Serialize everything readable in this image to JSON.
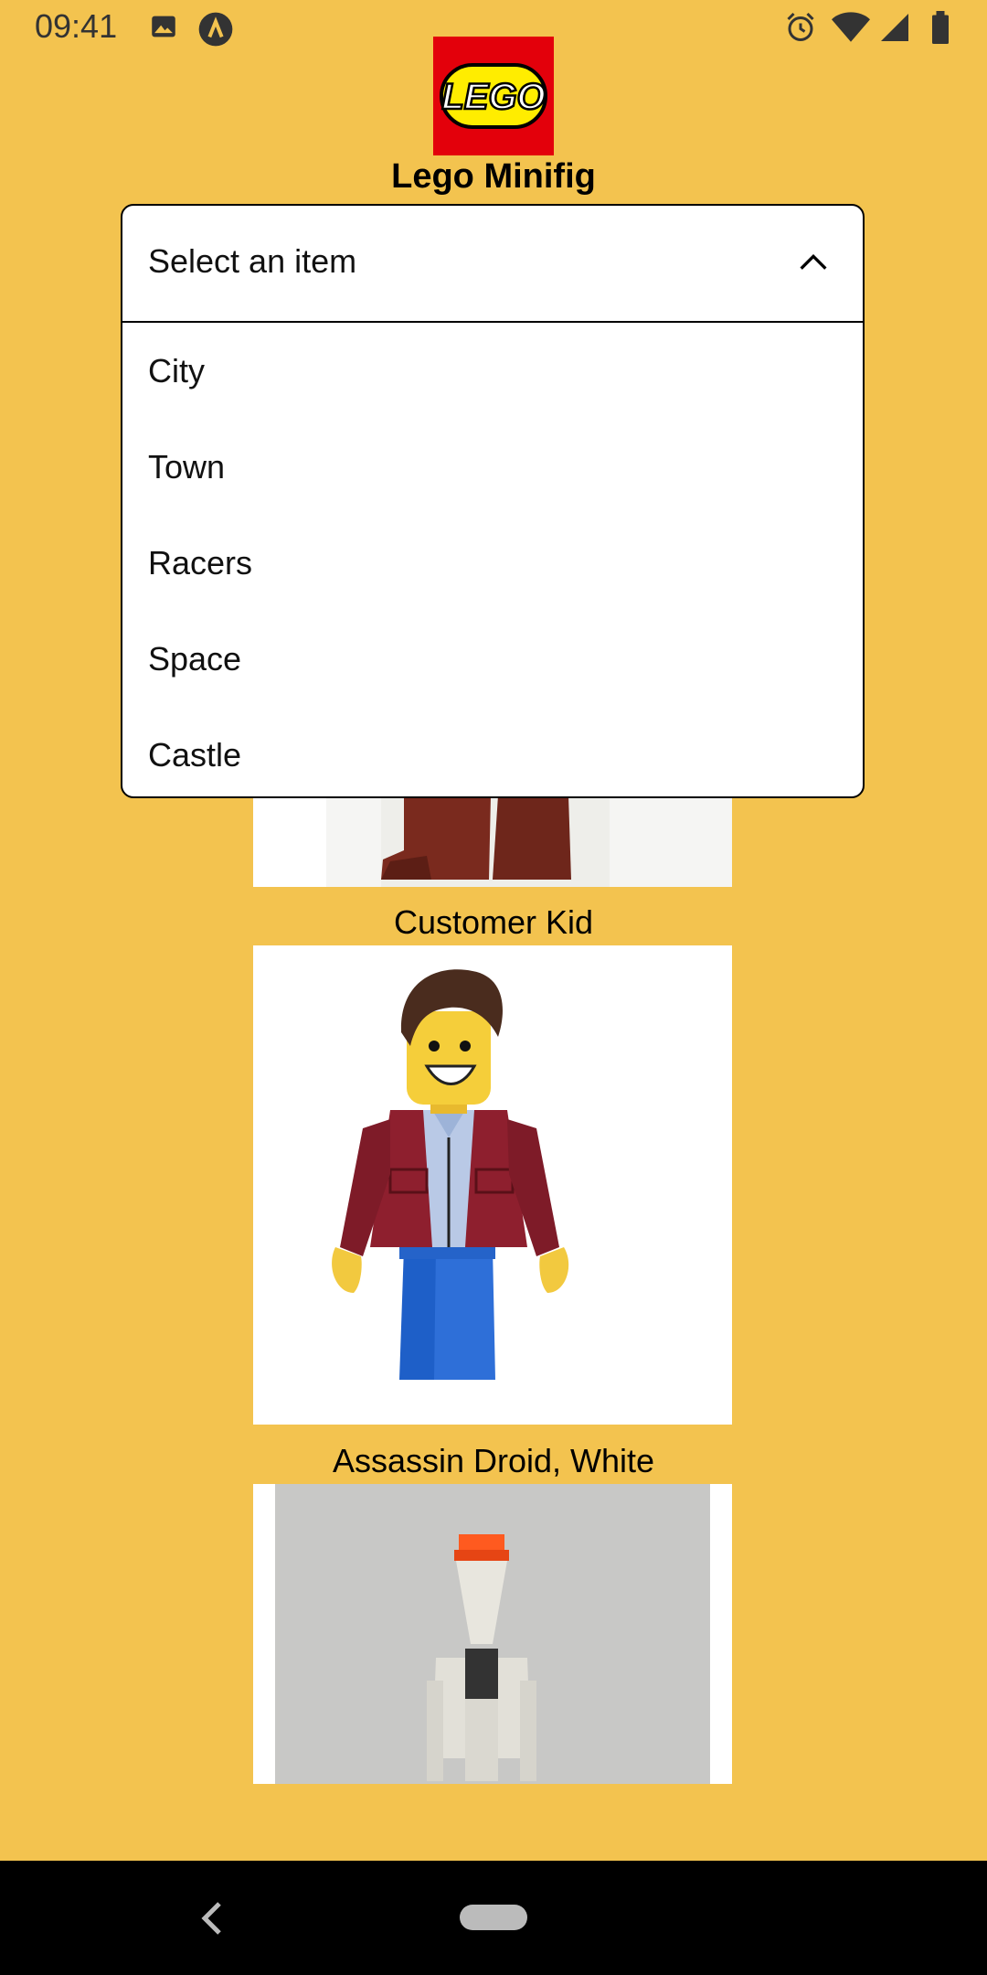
{
  "status": {
    "time": "09:41"
  },
  "app": {
    "title": "Lego Minifig",
    "logo_text": "LEGO"
  },
  "dropdown": {
    "selected": "Select an item",
    "options": [
      "City",
      "Town",
      "Racers",
      "Space",
      "Castle"
    ]
  },
  "items": [
    {
      "caption": "Customer Kid"
    },
    {
      "caption": "Assassin Droid, White"
    }
  ],
  "colors": {
    "background": "#F3C34F",
    "lego_red": "#E3000B"
  },
  "icons": [
    "image-icon",
    "a-logo-icon",
    "alarm-icon",
    "wifi-icon",
    "signal-icon",
    "battery-icon",
    "chevron-up-icon",
    "back-icon"
  ]
}
